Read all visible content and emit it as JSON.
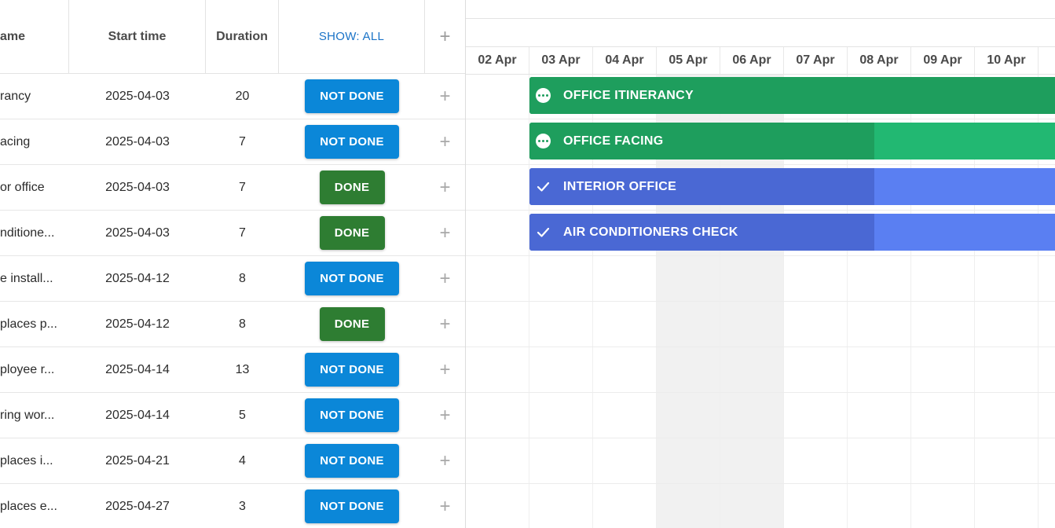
{
  "grid": {
    "headers": {
      "name": "ame",
      "start_time": "Start time",
      "duration": "Duration",
      "show_filter": "SHOW: ALL",
      "add": "+"
    },
    "rows": [
      {
        "name": "rancy",
        "start": "2025-04-03",
        "duration": "20",
        "status": "NOT DONE"
      },
      {
        "name": "acing",
        "start": "2025-04-03",
        "duration": "7",
        "status": "NOT DONE"
      },
      {
        "name": "or office",
        "start": "2025-04-03",
        "duration": "7",
        "status": "DONE"
      },
      {
        "name": "nditione...",
        "start": "2025-04-03",
        "duration": "7",
        "status": "DONE"
      },
      {
        "name": "e install...",
        "start": "2025-04-12",
        "duration": "8",
        "status": "NOT DONE"
      },
      {
        "name": "places p...",
        "start": "2025-04-12",
        "duration": "8",
        "status": "DONE"
      },
      {
        "name": "ployee r...",
        "start": "2025-04-14",
        "duration": "13",
        "status": "NOT DONE"
      },
      {
        "name": "ring wor...",
        "start": "2025-04-14",
        "duration": "5",
        "status": "NOT DONE"
      },
      {
        "name": "places i...",
        "start": "2025-04-21",
        "duration": "4",
        "status": "NOT DONE"
      },
      {
        "name": "places e...",
        "start": "2025-04-27",
        "duration": "3",
        "status": "NOT DONE"
      }
    ],
    "add_row_symbol": "+"
  },
  "timeline": {
    "dates": [
      "02 Apr",
      "03 Apr",
      "04 Apr",
      "05 Apr",
      "06 Apr",
      "07 Apr",
      "08 Apr",
      "09 Apr",
      "10 Apr",
      "1"
    ],
    "weekend_dates": [
      "05 Apr",
      "06 Apr"
    ],
    "bars": [
      {
        "label": "OFFICE ITINERANCY",
        "icon": "more-dots-icon",
        "status": "in-progress",
        "color": "#1e9e5d",
        "progress_color": "#1e9e5d"
      },
      {
        "label": "OFFICE FACING",
        "icon": "more-dots-icon",
        "status": "in-progress",
        "color": "#22b872",
        "progress_color": "#1e9e5d"
      },
      {
        "label": "INTERIOR OFFICE",
        "icon": "check-icon",
        "status": "done",
        "color": "#5a7ff2",
        "progress_color": "#4a68d4"
      },
      {
        "label": "AIR CONDITIONERS CHECK",
        "icon": "check-icon",
        "status": "done",
        "color": "#5a7ff2",
        "progress_color": "#4a68d4"
      }
    ]
  },
  "colors": {
    "not_done": "#0b87d8",
    "done": "#2e7d32",
    "show_link": "#1a73c7"
  }
}
